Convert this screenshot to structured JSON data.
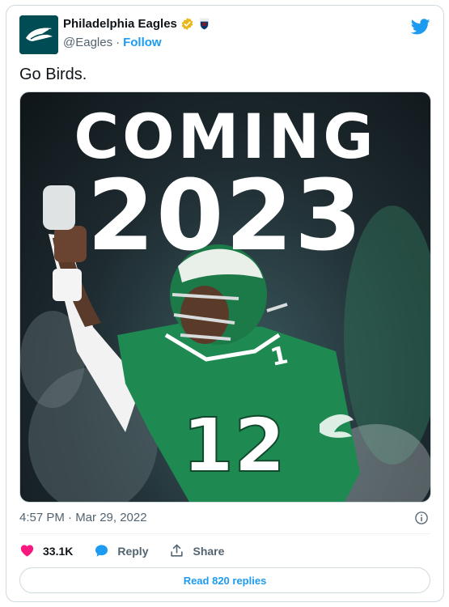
{
  "author": {
    "display_name": "Philadelphia Eagles",
    "handle": "@Eagles",
    "separator": "·",
    "follow_label": "Follow",
    "verified_icon": "verified-badge-icon",
    "affiliate_icon": "nfl-shield-icon",
    "avatar_color": "#004c54"
  },
  "tweet": {
    "text": "Go Birds.",
    "timestamp": "4:57 PM · Mar 29, 2022"
  },
  "media": {
    "headline": "COMING",
    "year": "2023",
    "jersey_number": "12",
    "jersey_color": "#1e8a52"
  },
  "actions": {
    "like_count": "33.1K",
    "reply_label": "Reply",
    "share_label": "Share",
    "read_replies_label": "Read 820 replies"
  },
  "colors": {
    "accent": "#1d9bf0",
    "like": "#f91880",
    "muted": "#536471"
  }
}
